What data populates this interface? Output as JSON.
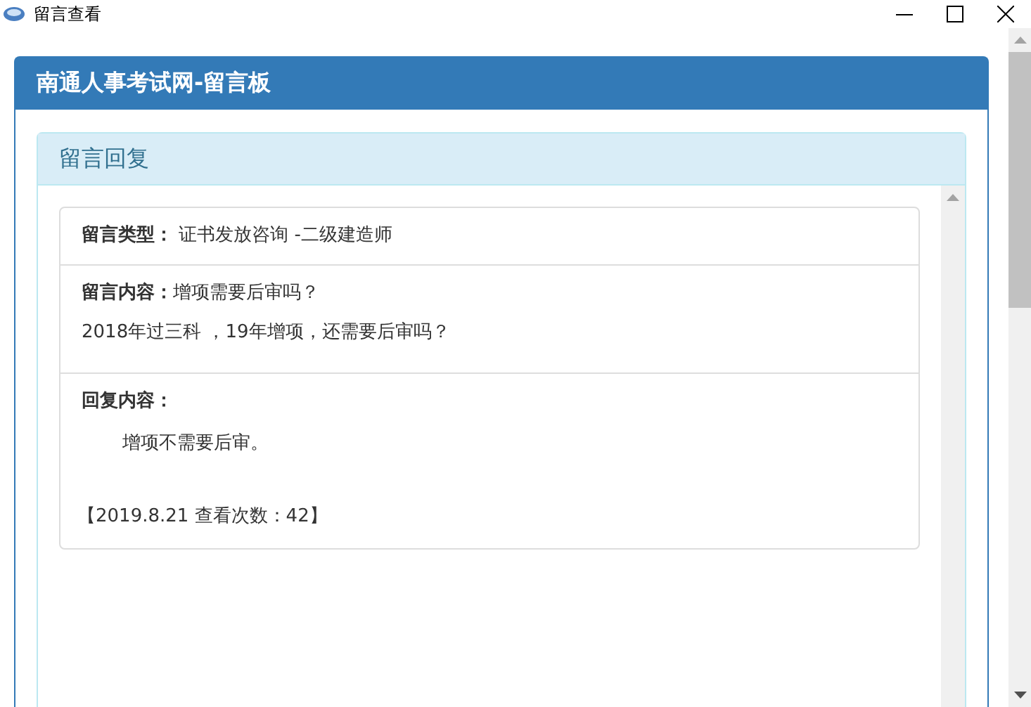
{
  "window": {
    "title": "留言查看"
  },
  "board": {
    "title": "南通人事考试网-留言板"
  },
  "panel": {
    "title": "留言回复"
  },
  "message": {
    "type_label": "留言类型：",
    "type_value": "证书发放咨询 -二级建造师",
    "content_label": "留言内容：",
    "content_title": "增项需要后审吗？",
    "content_body": "2018年过三科 ，19年增项，还需要后审吗？",
    "reply_label": "回复内容：",
    "reply_body": "增项不需要后审。",
    "footer": "【2019.8.21  查看次数：42】"
  }
}
